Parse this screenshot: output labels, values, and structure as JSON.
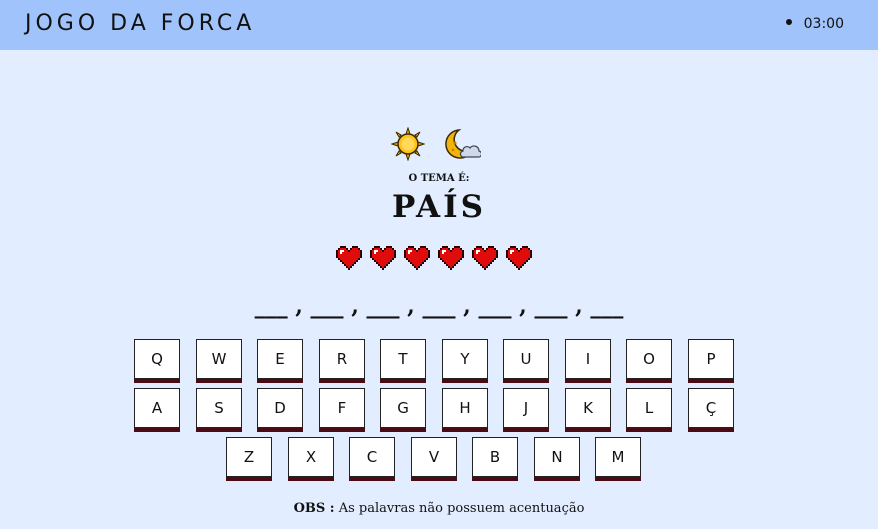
{
  "header": {
    "title": "JOGO DA FORCA",
    "timer": "03:00"
  },
  "mode_icons": [
    "sun-icon",
    "moon-cloud-icon"
  ],
  "theme": {
    "label": "O TEMA É:",
    "value": "PAÍS"
  },
  "lives": {
    "count": 6,
    "icon": "heart-icon",
    "color": "#e00b0b"
  },
  "word": {
    "display": "___ , ___ , ___ , ___ , ___ , ___ , ___"
  },
  "keyboard": {
    "rows": [
      [
        "Q",
        "W",
        "E",
        "R",
        "T",
        "Y",
        "U",
        "I",
        "O",
        "P"
      ],
      [
        "A",
        "S",
        "D",
        "F",
        "G",
        "H",
        "J",
        "K",
        "L",
        "Ç"
      ],
      [
        "Z",
        "X",
        "C",
        "V",
        "B",
        "N",
        "M"
      ]
    ]
  },
  "note": {
    "bold": "OBS :",
    "text": "As palavras não possuem acentuação"
  },
  "colors": {
    "header_bg": "#a1c3fb",
    "page_bg": "#e2edff",
    "key_shadow": "#4a0b14"
  }
}
